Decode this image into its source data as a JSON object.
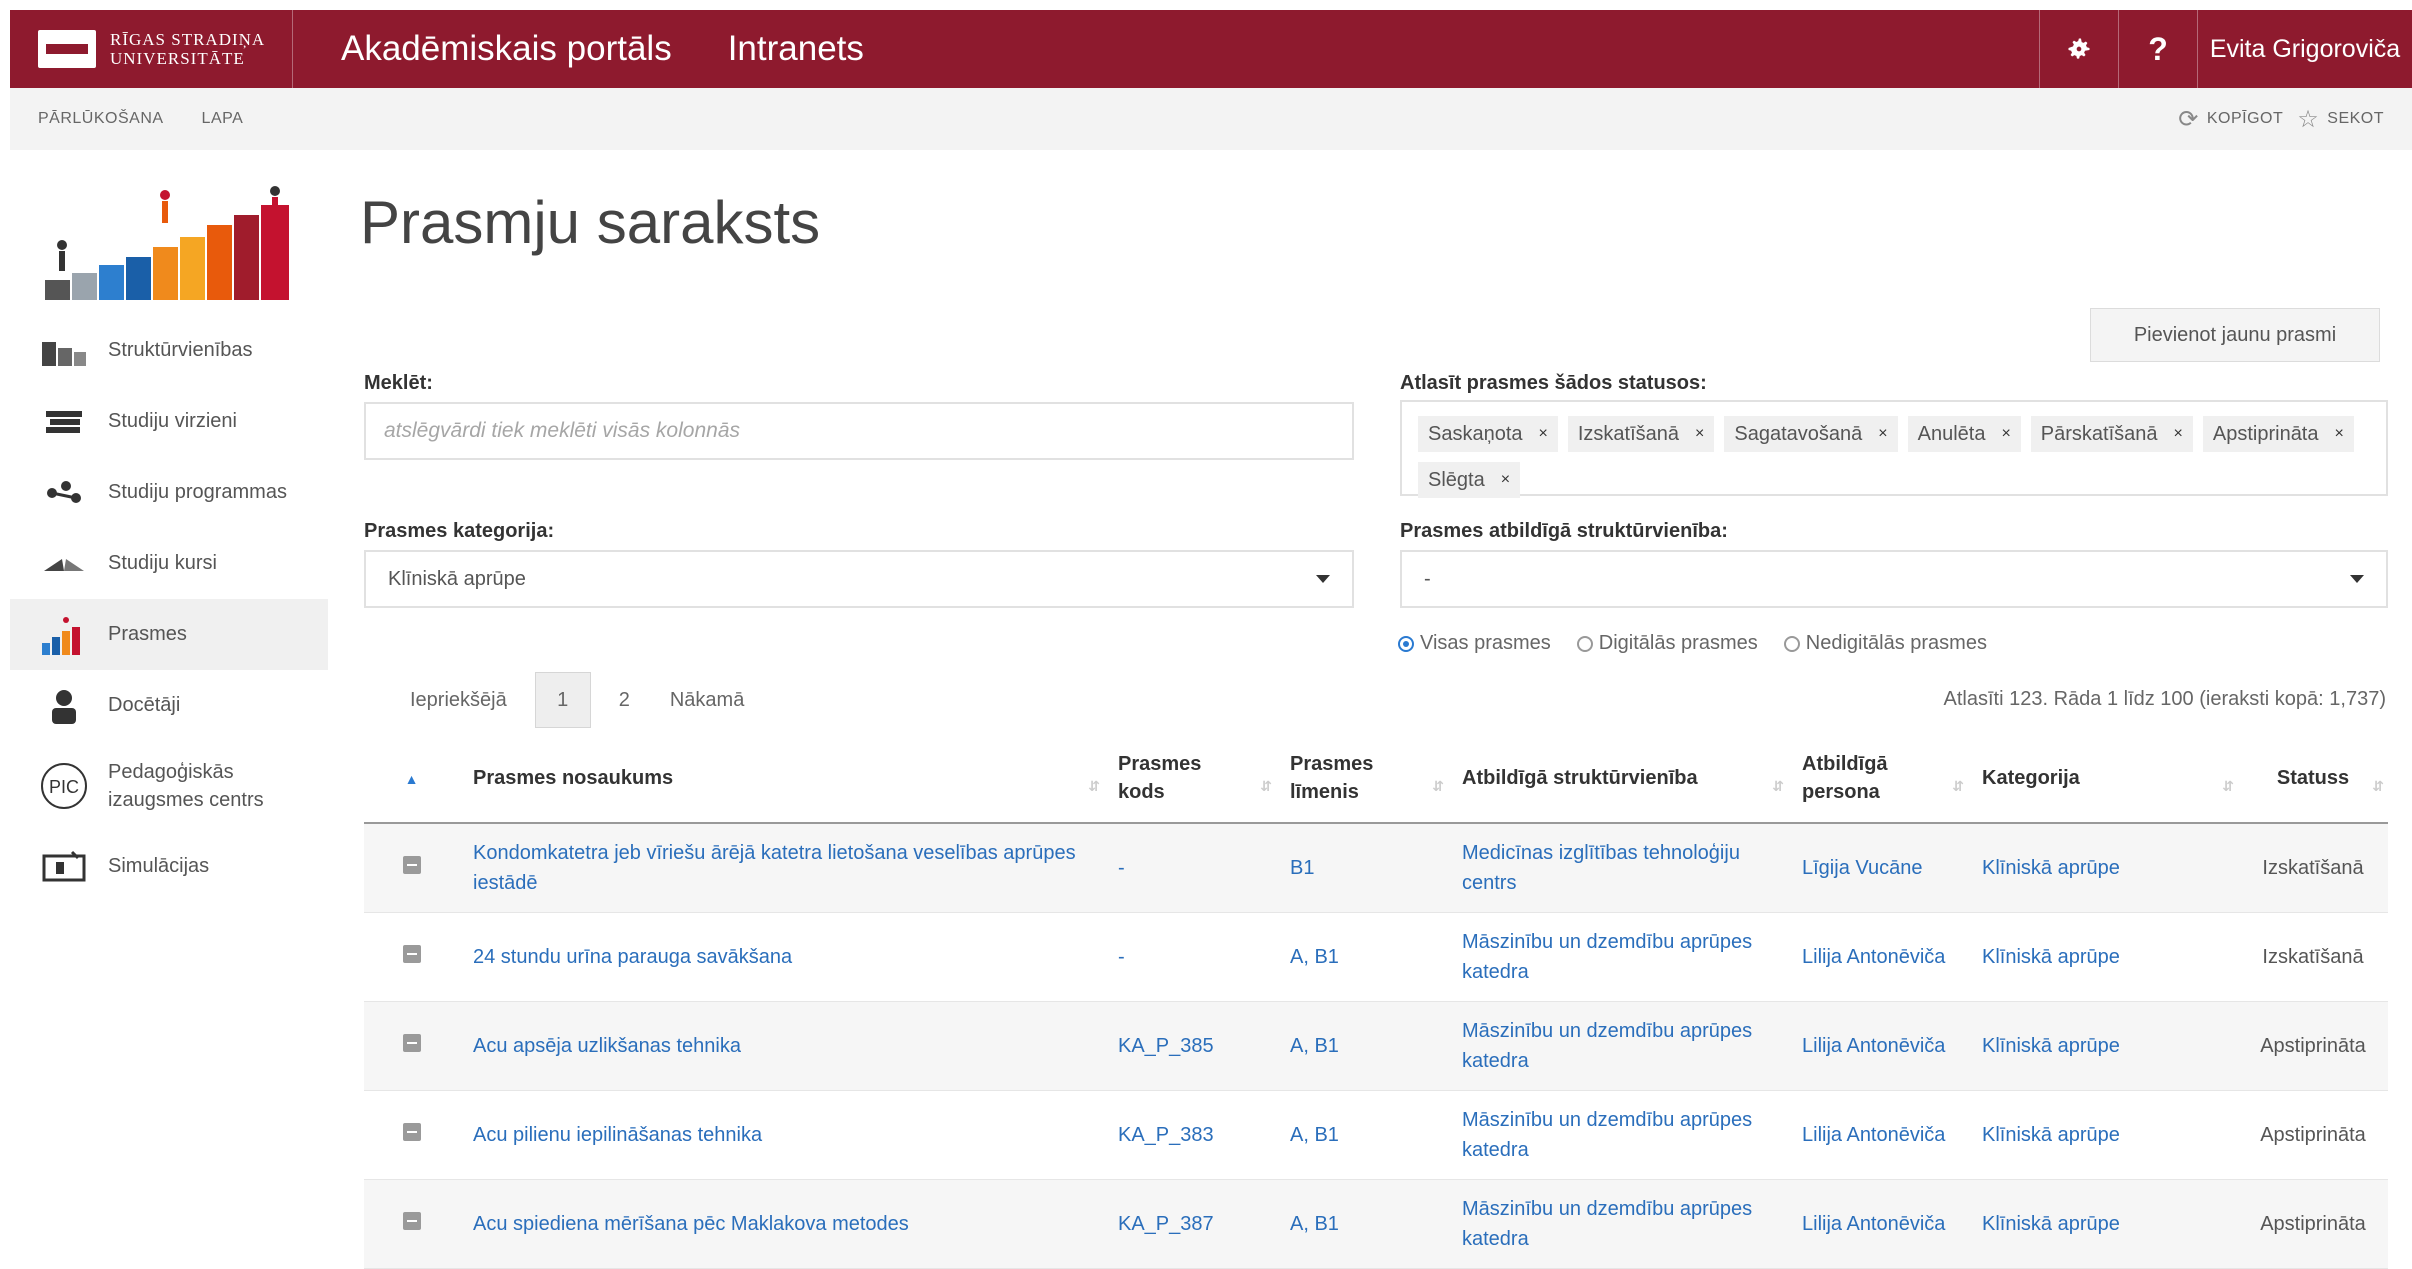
{
  "header": {
    "logo_line1": "Rīgas Stradiņa",
    "logo_line2": "Universitāte",
    "portal_title": "Akadēmiskais portāls",
    "intranet": "Intranets",
    "settings_icon": "gear-icon",
    "help_label": "?",
    "user_name": "Evita Grigoroviča",
    "brand_color": "#8e1a2e"
  },
  "ribbon": {
    "tab_browse": "PĀRLŪKOŠANA",
    "tab_page": "LAPA",
    "copy_label": "KOPĪGOT",
    "follow_label": "SEKOT"
  },
  "sidebar": {
    "items": [
      {
        "label": "Struktūrvienības",
        "icon": "buildings-icon"
      },
      {
        "label": "Studiju virzieni",
        "icon": "books-icon"
      },
      {
        "label": "Studiju programmas",
        "icon": "connections-icon"
      },
      {
        "label": "Studiju kursi",
        "icon": "open-book-icon"
      },
      {
        "label": "Prasmes",
        "icon": "skills-chart-icon"
      },
      {
        "label": "Docētāji",
        "icon": "person-icon"
      },
      {
        "label": "Pedagoģiskās izaugsmes centrs",
        "icon": "pic-icon",
        "badge": "PIC"
      },
      {
        "label": "Simulācijas",
        "icon": "monitor-icon"
      }
    ]
  },
  "main": {
    "title": "Prasmju saraksts",
    "add_button": "Pievienot jaunu prasmi",
    "search_label": "Meklēt:",
    "search_placeholder": "atslēgvārdi tiek meklēti visās kolonnās",
    "status_label": "Atlasīt prasmes šādos statusos:",
    "status_tags": [
      "Saskaņota",
      "Izskatīšanā",
      "Sagatavošanā",
      "Anulēta",
      "Pārskatīšanā",
      "Apstiprināta",
      "Slēgta"
    ],
    "category_label": "Prasmes kategorija:",
    "category_value": "Klīniskā aprūpe",
    "unit_label": "Prasmes atbildīgā struktūrvienība:",
    "unit_value": "-",
    "radios": [
      "Visas prasmes",
      "Digitālās prasmes",
      "Nedigitālās prasmes"
    ],
    "pager": {
      "prev": "Iepriekšējā",
      "page1": "1",
      "page2": "2",
      "next": "Nākamā"
    },
    "pager_info": "Atlasīti 123. Rāda 1 līdz 100 (ieraksti kopā: 1,737)"
  },
  "table": {
    "headers": [
      "Prasmes nosaukums",
      "Prasmes kods",
      "Prasmes līmenis",
      "Atbildīgā struktūrvienība",
      "Atbildīgā persona",
      "Kategorija",
      "Statuss"
    ],
    "rows": [
      {
        "name": "Kondomkatetra jeb vīriešu ārējā katetra lietošana veselības aprūpes iestādē",
        "code": "-",
        "level": "B1",
        "unit": "Medicīnas izglītības tehnoloģiju centrs",
        "person": "Līgija Vucāne",
        "category": "Klīniskā aprūpe",
        "status": "Izskatīšanā"
      },
      {
        "name": "24 stundu urīna parauga savākšana",
        "code": "-",
        "level": "A, B1",
        "unit": "Māszinību un dzemdību aprūpes katedra",
        "person": "Lilija Antonēviča",
        "category": "Klīniskā aprūpe",
        "status": "Izskatīšanā"
      },
      {
        "name": "Acu apsēja uzlikšanas tehnika",
        "code": "KA_P_385",
        "level": "A, B1",
        "unit": "Māszinību un dzemdību aprūpes katedra",
        "person": "Lilija Antonēviča",
        "category": "Klīniskā aprūpe",
        "status": "Apstiprināta"
      },
      {
        "name": "Acu pilienu iepilināšanas tehnika",
        "code": "KA_P_383",
        "level": "A, B1",
        "unit": "Māszinību un dzemdību aprūpes katedra",
        "person": "Lilija Antonēviča",
        "category": "Klīniskā aprūpe",
        "status": "Apstiprināta"
      },
      {
        "name": "Acu spiediena mērīšana pēc Maklakova metodes",
        "code": "KA_P_387",
        "level": "A, B1",
        "unit": "Māszinību un dzemdību aprūpes katedra",
        "person": "Lilija Antonēviča",
        "category": "Klīniskā aprūpe",
        "status": "Apstiprināta"
      }
    ]
  }
}
